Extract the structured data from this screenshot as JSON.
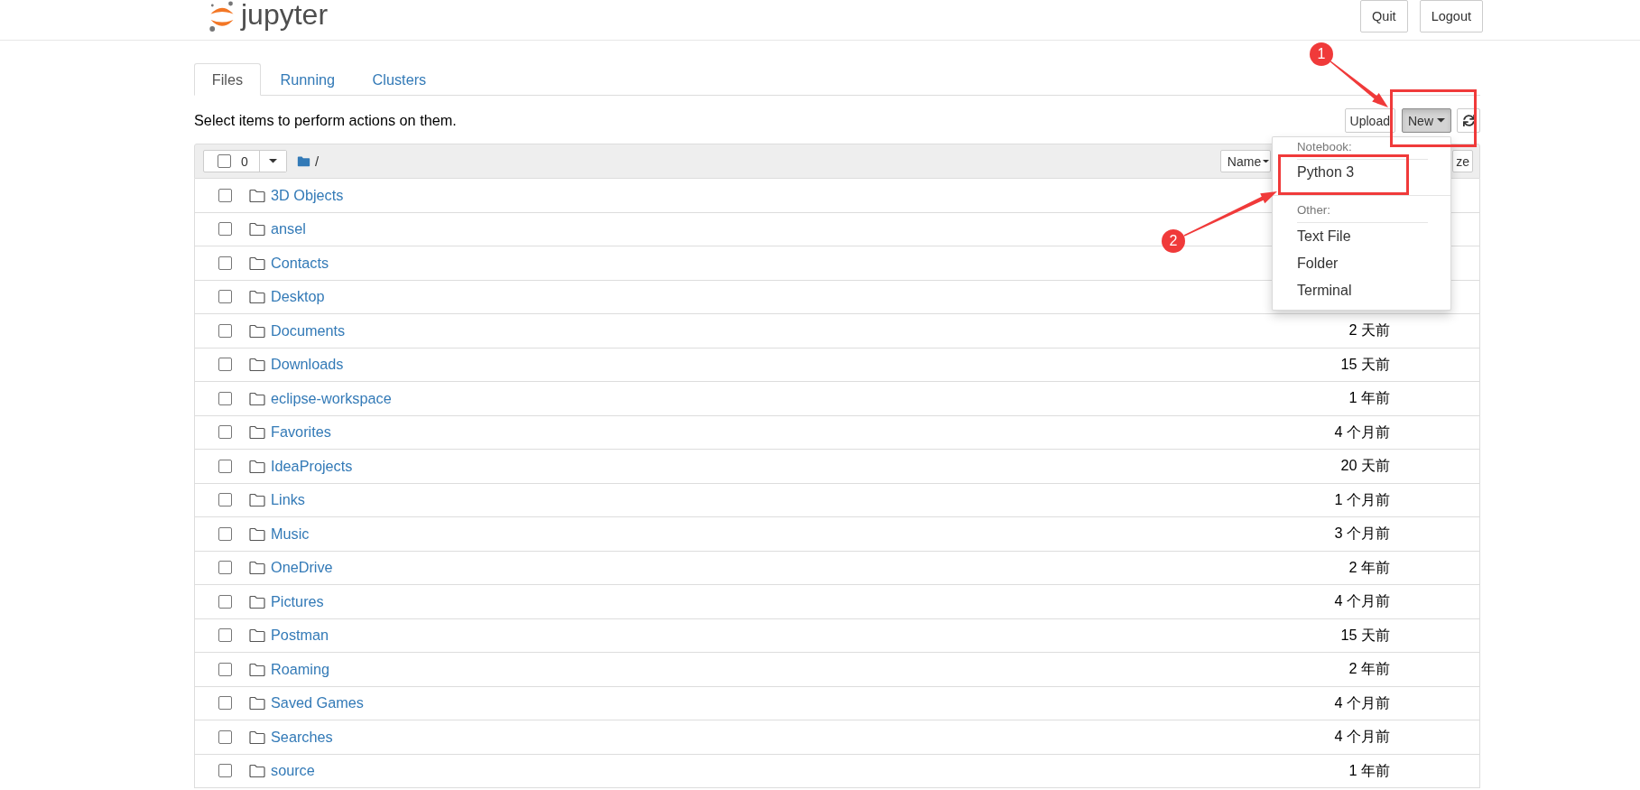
{
  "header": {
    "logo_text": "jupyter",
    "buttons": [
      "Quit",
      "Logout"
    ]
  },
  "tabs": [
    {
      "label": "Files",
      "selected": true
    },
    {
      "label": "Running",
      "selected": false
    },
    {
      "label": "Clusters",
      "selected": false
    }
  ],
  "toolbar": {
    "hint": "Select items to perform actions on them.",
    "upload_label": "Upload",
    "new_button": {
      "label": "New",
      "expanded": true,
      "menu": [
        {
          "header": "Notebook:",
          "items": [
            "Python 3"
          ]
        },
        {
          "header": "Other:",
          "items": [
            "Text File",
            "Folder",
            "Terminal"
          ]
        }
      ]
    }
  },
  "list_header": {
    "select_all": {
      "checked": false
    },
    "selected_count": "0",
    "path": "/",
    "name_column": "Name",
    "column_3": "ze"
  },
  "rows": [
    {
      "name": "3D Objects",
      "checked": false
    },
    {
      "name": "ansel",
      "checked": false
    },
    {
      "name": "Contacts",
      "checked": false
    },
    {
      "name": "Desktop",
      "checked": false
    },
    {
      "name": "Documents",
      "checked": false,
      "time": "2 天前"
    },
    {
      "name": "Downloads",
      "checked": false,
      "time": "15 天前"
    },
    {
      "name": "eclipse-workspace",
      "checked": false,
      "time": "1 年前"
    },
    {
      "name": "Favorites",
      "checked": false,
      "time": "4 个月前"
    },
    {
      "name": "IdeaProjects",
      "checked": false,
      "time": "20 天前"
    },
    {
      "name": "Links",
      "checked": false,
      "time": "1 个月前"
    },
    {
      "name": "Music",
      "checked": false,
      "time": "3 个月前"
    },
    {
      "name": "OneDrive",
      "checked": false,
      "time": "2 年前"
    },
    {
      "name": "Pictures",
      "checked": false,
      "time": "4 个月前"
    },
    {
      "name": "Postman",
      "checked": false,
      "time": "15 天前"
    },
    {
      "name": "Roaming",
      "checked": false,
      "time": "2 年前"
    },
    {
      "name": "Saved Games",
      "checked": false,
      "time": "4 个月前"
    },
    {
      "name": "Searches",
      "checked": false,
      "time": "4 个月前"
    },
    {
      "name": "source",
      "checked": false,
      "time": "1 年前"
    }
  ],
  "callouts": [
    {
      "number": "1"
    },
    {
      "number": "2"
    }
  ]
}
